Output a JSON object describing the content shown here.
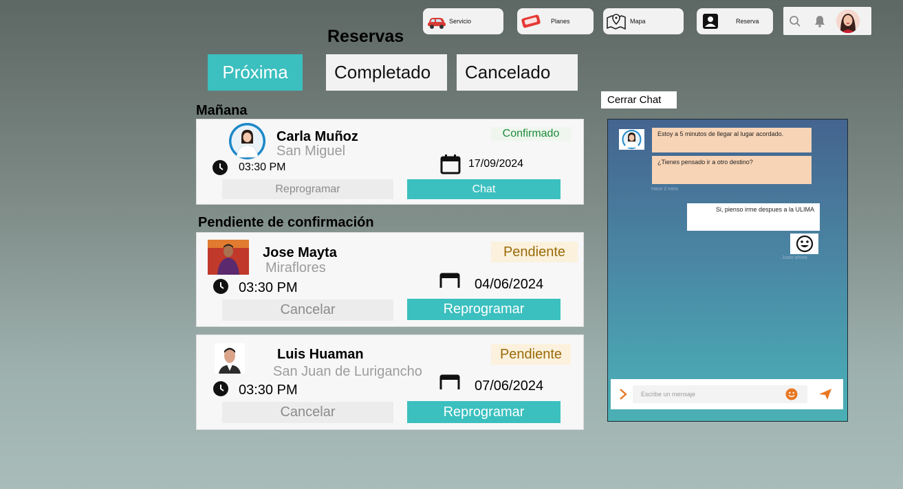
{
  "nav": {
    "servicio": "Servicio",
    "planes": "Planes",
    "mapa": "Mapa",
    "reserva": "Reserva"
  },
  "page_title": "Reservas",
  "tabs": [
    "Próxima",
    "Completado",
    "Cancelado"
  ],
  "sections": {
    "tomorrow": "Mañana",
    "pending": "Pendiente de confirmación"
  },
  "bookings": [
    {
      "name": "Carla Muñoz",
      "location": "San Miguel",
      "time": "03:30 PM",
      "date": "17/09/2024",
      "status": "Confirmado",
      "secondary_action": "Reprogramar",
      "primary_action": "Chat"
    },
    {
      "name": "Jose Mayta",
      "location": "Miraflores",
      "time": "03:30 PM",
      "date": "04/06/2024",
      "status": "Pendiente",
      "secondary_action": "Cancelar",
      "primary_action": "Reprogramar"
    },
    {
      "name": "Luis Huaman",
      "location": "San Juan de Lurigancho",
      "time": "03:30 PM",
      "date": "07/06/2024",
      "status": "Pendiente",
      "secondary_action": "Cancelar",
      "primary_action": "Reprogramar"
    }
  ],
  "chat": {
    "close_label": "Cerrar Chat",
    "messages": [
      {
        "from": "other",
        "text": "Estoy a 5 minutos de llegar al lugar acordado."
      },
      {
        "from": "other",
        "text": "¿Tienes pensado ir a otro destino?"
      },
      {
        "from": "me",
        "text": "Si, pienso irme despues a la ULIMA"
      }
    ],
    "received_meta": "Hace 2 mins",
    "sent_meta": "Justo ahora",
    "input_placeholder": "Escribe un mensaje"
  },
  "colors": {
    "accent": "#3bbfbf",
    "confirmed": "#1d8a3a",
    "pending": "#9a6a08",
    "send_icon": "#e87722"
  }
}
